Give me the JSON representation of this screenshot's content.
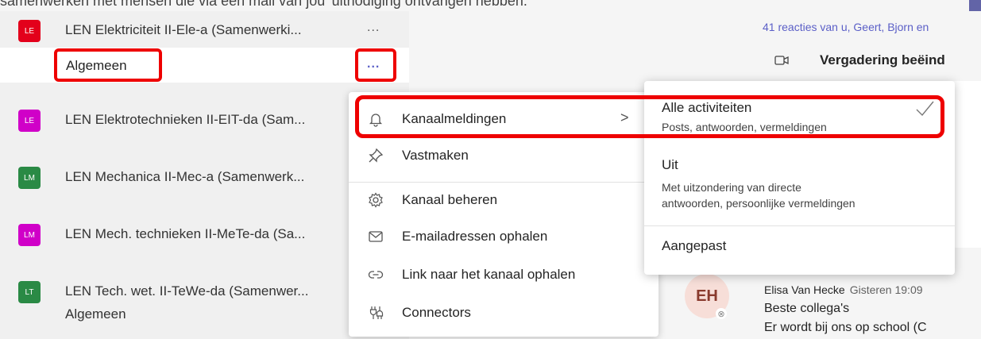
{
  "colors": {
    "accent": "#5b5fc7",
    "highlight_red": "#ee0000"
  },
  "top_partial_text": "samenwerken met mensen die via een mail van jou 'uitnodiging ontvangen hebben.'",
  "sidebar": {
    "teams": [
      {
        "initials": "LE",
        "color": "#e3001b",
        "name": "LEN Elektriciteit II-Ele-a (Samenwerki..."
      },
      {
        "initials": "LE",
        "color": "#d000c8",
        "name": "LEN Elektrotechnieken II-EIT-da (Sam..."
      },
      {
        "initials": "LM",
        "color": "#2a8a45",
        "name": "LEN Mechanica II-Mec-a (Samenwerk..."
      },
      {
        "initials": "LM",
        "color": "#d000c8",
        "name": "LEN Mech. technieken II-MeTe-da (Sa..."
      },
      {
        "initials": "LT",
        "color": "#2a8a45",
        "name": "LEN Tech. wet. II-TeWe-da (Samenwer..."
      }
    ],
    "more_icon": "...",
    "selected_channel": "Algemeen",
    "bottom_channel": "Algemeen"
  },
  "context_menu": {
    "items": [
      {
        "icon": "bell-icon",
        "label": "Kanaalmeldingen",
        "has_submenu": true
      },
      {
        "icon": "pin-icon",
        "label": "Vastmaken"
      },
      {
        "icon": "gear-icon",
        "label": "Kanaal beheren"
      },
      {
        "icon": "mail-icon",
        "label": "E-mailadressen ophalen"
      },
      {
        "icon": "link-icon",
        "label": "Link naar het kanaal ophalen"
      },
      {
        "icon": "connectors-icon",
        "label": "Connectors"
      }
    ],
    "chevron": ">"
  },
  "notification_submenu": {
    "options": [
      {
        "title": "Alle activiteiten",
        "description": "Posts, antwoorden, vermeldingen",
        "selected": true
      },
      {
        "title": "Uit",
        "description_lines": [
          "Met uitzondering van directe",
          "antwoorden, persoonlijke vermeldingen"
        ]
      },
      {
        "title": "Aangepast"
      }
    ]
  },
  "right_pane": {
    "reacties": "41 reacties van u, Geert, Bjorn en",
    "meeting_title": "Vergadering beëind",
    "message": {
      "avatar_initials": "EH",
      "author": "Elisa Van Hecke",
      "time": "Gisteren 19:09",
      "line1": "Beste collega's",
      "line2": "Er wordt bij ons op school (C"
    }
  }
}
